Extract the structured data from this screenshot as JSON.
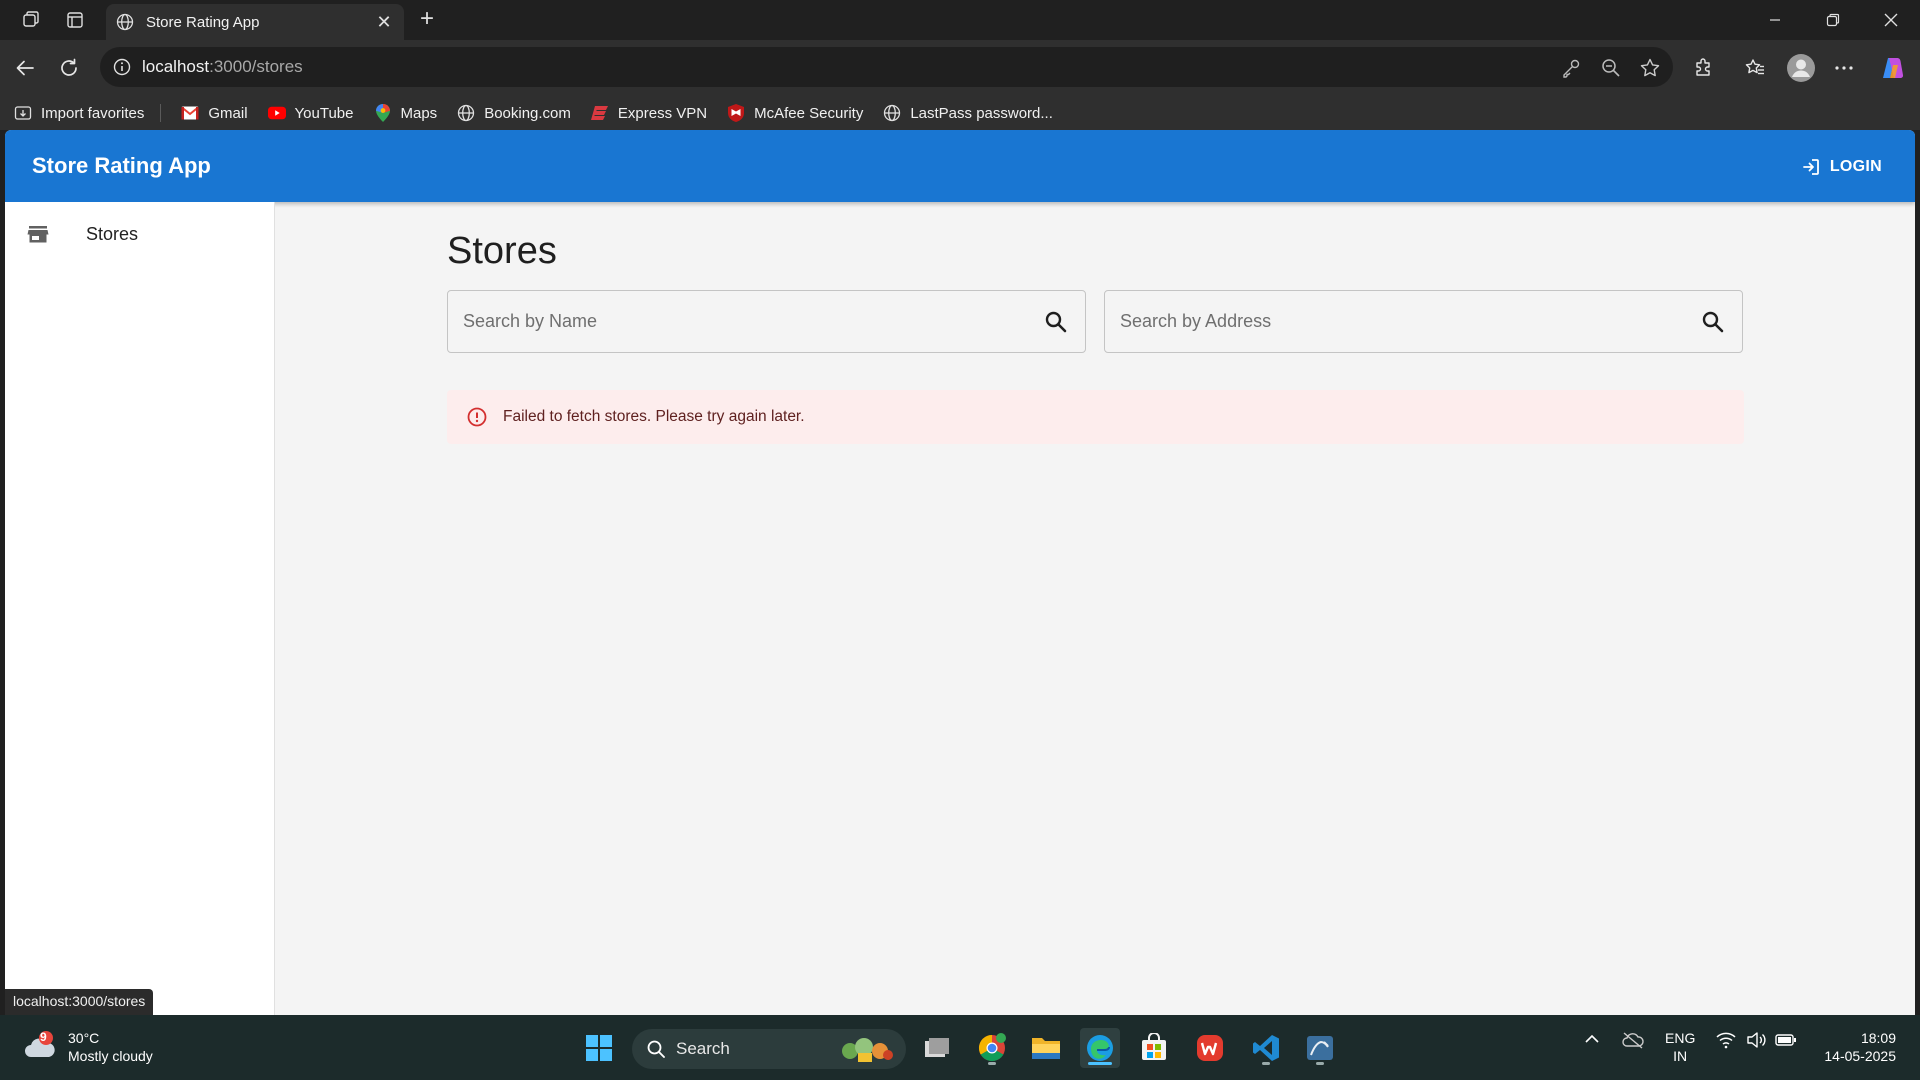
{
  "browser": {
    "tab_title": "Store Rating App",
    "url_host": "localhost",
    "url_path": ":3000/stores",
    "bookmarks": [
      {
        "label": "Import favorites",
        "icon": "import-icon"
      },
      {
        "label": "Gmail",
        "icon": "gmail-icon"
      },
      {
        "label": "YouTube",
        "icon": "youtube-icon"
      },
      {
        "label": "Maps",
        "icon": "maps-icon"
      },
      {
        "label": "Booking.com",
        "icon": "globe-icon"
      },
      {
        "label": "Express VPN",
        "icon": "expressvpn-icon"
      },
      {
        "label": "McAfee Security",
        "icon": "mcafee-icon"
      },
      {
        "label": "LastPass password...",
        "icon": "globe-icon"
      }
    ],
    "status_url": "localhost:3000/stores"
  },
  "app": {
    "title": "Store Rating App",
    "login_label": "LOGIN",
    "sidebar": {
      "items": [
        {
          "label": "Stores",
          "icon": "store-icon"
        }
      ]
    },
    "page_title": "Stores",
    "search_name": {
      "placeholder": "Search by Name",
      "value": ""
    },
    "search_address": {
      "placeholder": "Search by Address",
      "value": ""
    },
    "error_message": "Failed to fetch stores. Please try again later.",
    "colors": {
      "primary": "#1976d2",
      "error_bg": "#fdeded",
      "error_icon": "#d32f2f"
    }
  },
  "taskbar": {
    "weather": {
      "temp": "30°C",
      "condition": "Mostly cloudy",
      "badge": "9"
    },
    "search_label": "Search",
    "lang": {
      "line1": "ENG",
      "line2": "IN"
    },
    "clock": {
      "time": "18:09",
      "date": "14-05-2025"
    }
  }
}
